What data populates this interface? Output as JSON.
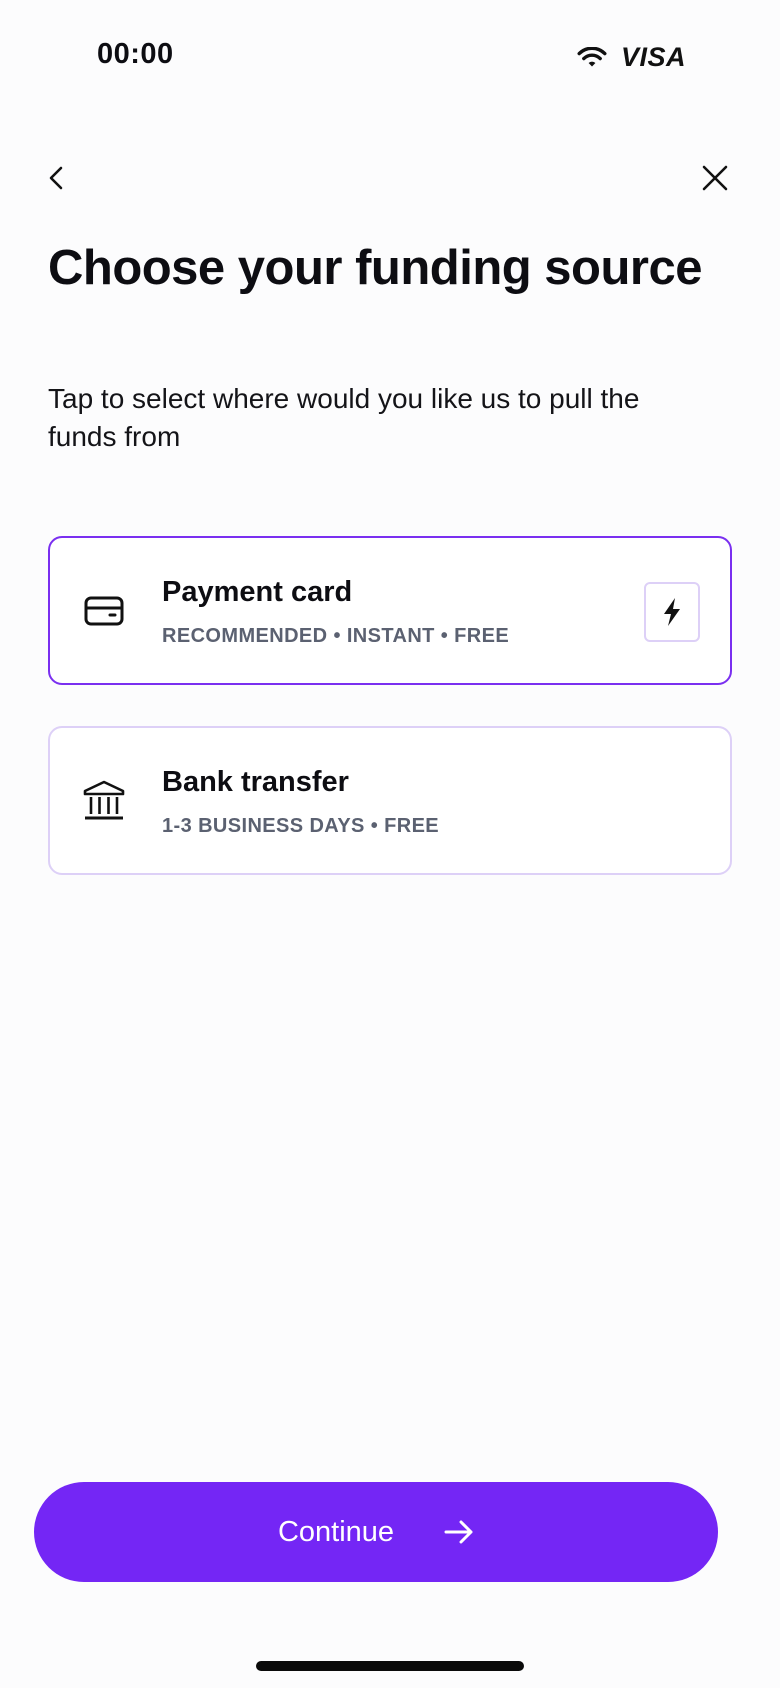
{
  "status_bar": {
    "time": "00:00",
    "brand": "VISA",
    "wifi_icon": "wifi-icon"
  },
  "nav": {
    "back_icon": "chevron-left-icon",
    "close_icon": "close-icon"
  },
  "title": "Choose your funding source",
  "subtitle": "Tap to select where would you like us to pull the funds from",
  "options": [
    {
      "icon": "credit-card-icon",
      "title": "Payment card",
      "meta": "RECOMMENDED • INSTANT • FREE",
      "selected": true,
      "badge_icon": "lightning-icon"
    },
    {
      "icon": "bank-icon",
      "title": "Bank transfer",
      "meta": "1-3 BUSINESS DAYS • FREE",
      "selected": false
    }
  ],
  "continue_button": {
    "label": "Continue",
    "icon": "arrow-right-icon"
  },
  "colors": {
    "accent": "#7426f5",
    "selected_border": "#7a2ff0",
    "unselected_border": "#ddd0f7",
    "meta_text": "#5b6171"
  }
}
